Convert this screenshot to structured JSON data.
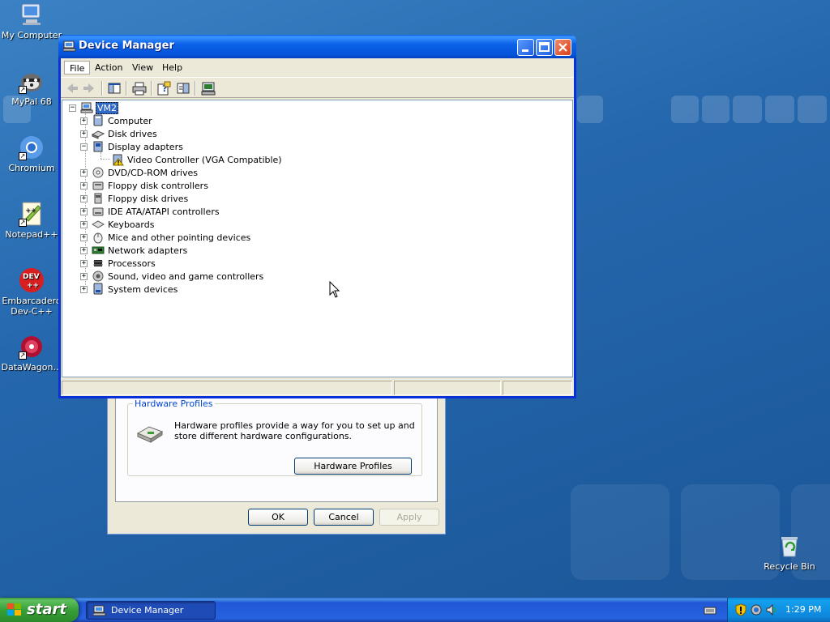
{
  "desktop": {
    "icons": [
      {
        "label": "My Computer",
        "icon": "my-computer-icon"
      },
      {
        "label": "MyPal 68",
        "icon": "mypal-browser-icon"
      },
      {
        "label": "Chromium",
        "icon": "chromium-icon"
      },
      {
        "label": "Notepad++",
        "icon": "notepadpp-icon"
      },
      {
        "label": "Embarcadero Dev-C++",
        "icon": "devcpp-icon"
      },
      {
        "label": "DataWagon…",
        "icon": "datawagon-icon"
      },
      {
        "label": "Recycle Bin",
        "icon": "recycle-bin-icon"
      }
    ]
  },
  "device_manager": {
    "title": "Device Manager",
    "menu": [
      "File",
      "Action",
      "View",
      "Help"
    ],
    "toolbar": [
      "back-icon",
      "forward-icon",
      "show-hide-console-tree-icon",
      "print-icon",
      "properties-help-icon",
      "properties-icon",
      "scan-hardware-icon"
    ],
    "tree": {
      "root": "VM2",
      "items": [
        {
          "label": "Computer",
          "icon": "computer-icon",
          "expanded": false
        },
        {
          "label": "Disk drives",
          "icon": "disk-drive-icon",
          "expanded": false
        },
        {
          "label": "Display adapters",
          "icon": "display-adapter-icon",
          "expanded": true,
          "children": [
            {
              "label": "Video Controller (VGA Compatible)",
              "icon": "warning-device-icon"
            }
          ]
        },
        {
          "label": "DVD/CD-ROM drives",
          "icon": "cdrom-icon",
          "expanded": false
        },
        {
          "label": "Floppy disk controllers",
          "icon": "floppy-controller-icon",
          "expanded": false
        },
        {
          "label": "Floppy disk drives",
          "icon": "floppy-drive-icon",
          "expanded": false
        },
        {
          "label": "IDE ATA/ATAPI controllers",
          "icon": "ide-controller-icon",
          "expanded": false
        },
        {
          "label": "Keyboards",
          "icon": "keyboard-icon",
          "expanded": false
        },
        {
          "label": "Mice and other pointing devices",
          "icon": "mouse-icon",
          "expanded": false
        },
        {
          "label": "Network adapters",
          "icon": "network-adapter-icon",
          "expanded": false
        },
        {
          "label": "Processors",
          "icon": "processor-icon",
          "expanded": false
        },
        {
          "label": "Sound, video and game controllers",
          "icon": "sound-icon",
          "expanded": false
        },
        {
          "label": "System devices",
          "icon": "system-devices-icon",
          "expanded": false
        }
      ]
    }
  },
  "system_properties": {
    "group_title": "Hardware Profiles",
    "description": "Hardware profiles provide a way for you to set up and store different hardware configurations.",
    "hardware_profiles_button": "Hardware Profiles",
    "ok": "OK",
    "cancel": "Cancel",
    "apply": "Apply"
  },
  "taskbar": {
    "start_label": "start",
    "task_label": "Device Manager",
    "clock": "1:29 PM"
  },
  "colors": {
    "desktop": "#2567ad",
    "titlebar": "#0554d9",
    "selection": "#316ac5",
    "start_button": "#37a037"
  }
}
